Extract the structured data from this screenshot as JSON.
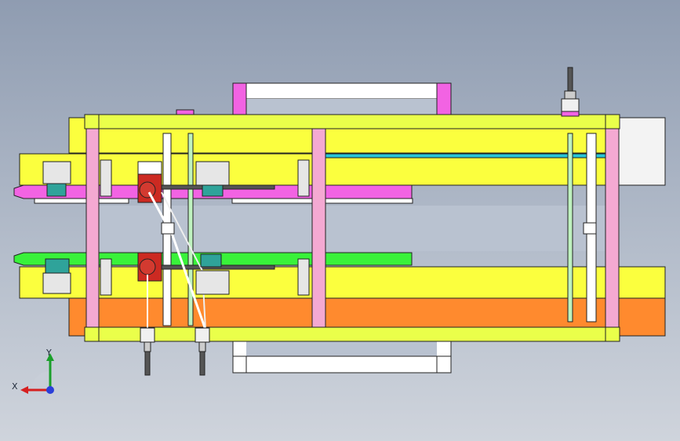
{
  "axis_triad": {
    "x_label": "X",
    "y_label": "Y"
  },
  "colors": {
    "background_top": "#8f9cb1",
    "background_bottom": "#cfd4dc",
    "frame_yellow": "#fbff3e",
    "frame_lime": "#eaff4a",
    "pillar_pink": "#f4a9d2",
    "bracket_magenta": "#f263e3",
    "rail_green": "#39f23a",
    "plate_orange": "#ff8a2e",
    "motor_red": "#cc2a22",
    "gripper_teal": "#2fa39a",
    "rod_green": "#bff2bf",
    "stripe_cyan": "#27c6d8",
    "outline": "#222222"
  }
}
